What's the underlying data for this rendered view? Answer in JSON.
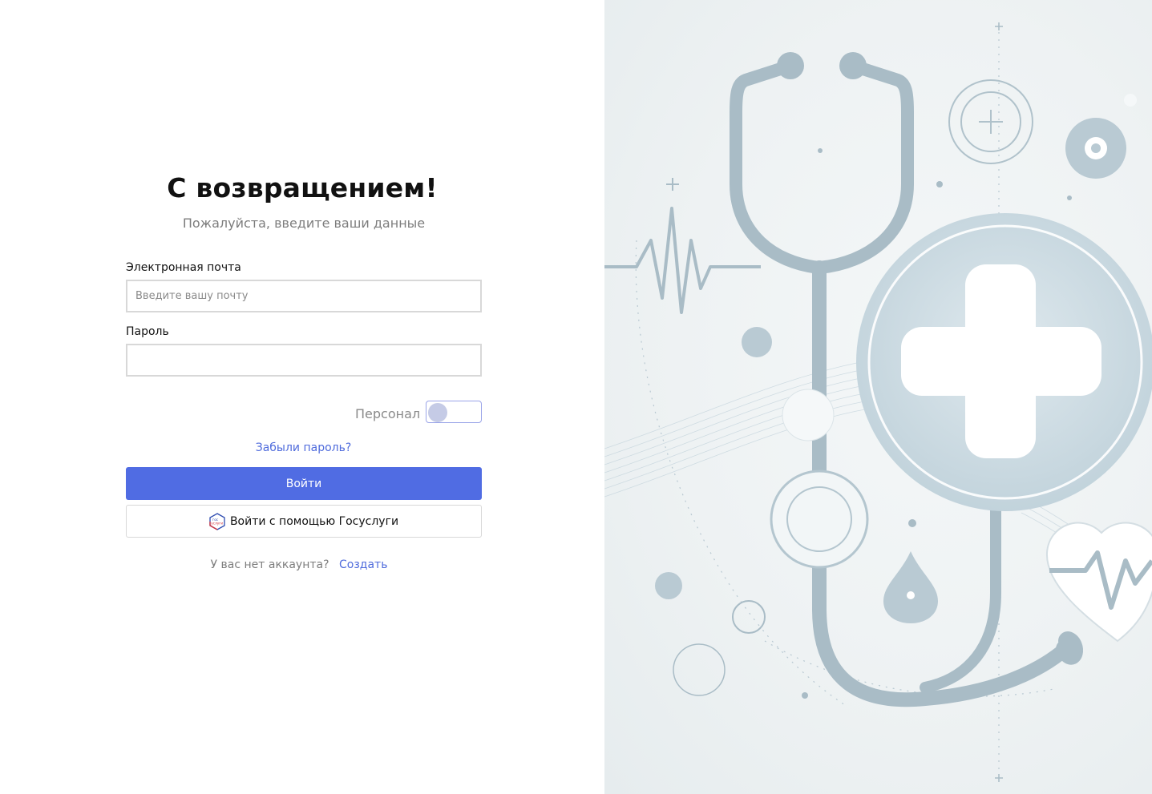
{
  "login": {
    "title": "С возвращением!",
    "subtitle": "Пожалуйста, введите ваши данные",
    "email_label": "Электронная почта",
    "email_placeholder": "Введите вашу почту",
    "email_value": "",
    "password_label": "Пароль",
    "password_value": "",
    "staff_label": "Персонал",
    "staff_toggle_on": false,
    "forgot_password": "Забыли пароль?",
    "login_button": "Войти",
    "gosuslugi_button": "Войти с помощью Госуслуги",
    "gosuslugi_logo_text": [
      "гос",
      "услуги"
    ],
    "no_account": "У вас нет аккаунта?",
    "create_link": "Создать"
  },
  "colors": {
    "accent": "#506ce3",
    "link": "#4f6bdc",
    "muted_text": "#7d7d7d",
    "illustration": "#a9bcc6"
  },
  "illustration": {
    "icons": [
      "stethoscope-icon",
      "medical-cross-icon",
      "heart-pulse-icon",
      "heartbeat-line-icon",
      "water-drop-icon"
    ]
  }
}
